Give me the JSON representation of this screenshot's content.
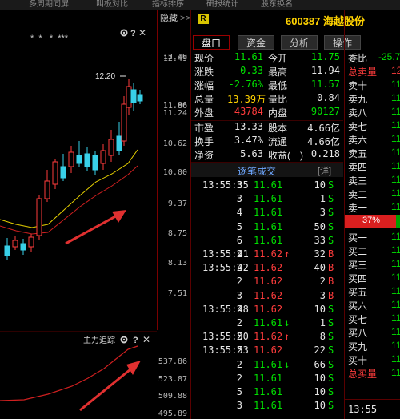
{
  "topbar": {
    "items": [
      "",
      "多周期同屏",
      "",
      "叫板对比",
      "",
      "指标排序",
      "",
      "研报统计",
      "",
      "股东换名"
    ]
  },
  "chart": {
    "hidden_label": "隐藏",
    "top_markers": "* *  * ***",
    "icons": {
      "settings": "gear-icon",
      "help": "question-icon",
      "close": "close-icon"
    },
    "high_label": "12.20",
    "price_ticks": [
      "12.49",
      "11.86",
      "11.24",
      "10.62",
      "10.00",
      "9.37",
      "8.75",
      "8.13",
      "7.51"
    ],
    "indicator_name": "主力追踪",
    "indicator_ticks": [
      "537.86",
      "523.87",
      "509.88",
      "495.89"
    ]
  },
  "quote": {
    "code": "600387",
    "name": "海越股份",
    "badge": "R",
    "tabs": [
      "盘口",
      "资金",
      "分析",
      "操作"
    ],
    "fields": [
      {
        "l1": "现价",
        "v1": "11.61",
        "c1": "green",
        "l2": "今开",
        "v2": "11.75",
        "c2": "green"
      },
      {
        "l1": "涨跌",
        "v1": "-0.33",
        "c1": "green",
        "l2": "最高",
        "v2": "11.94",
        "c2": "white"
      },
      {
        "l1": "涨幅",
        "v1": "-2.76%",
        "c1": "green",
        "l2": "最低",
        "v2": "11.57",
        "c2": "green"
      },
      {
        "l1": "总量",
        "v1": "13.39万",
        "c1": "yellow",
        "l2": "量比",
        "v2": "0.84",
        "c2": "white"
      },
      {
        "l1": "外盘",
        "v1": "43784",
        "c1": "red",
        "l2": "内盘",
        "v2": "90127",
        "c2": "green"
      }
    ],
    "fields2": [
      {
        "l1": "市盈",
        "v1": "13.33",
        "l2": "股本",
        "v2": "4.66亿"
      },
      {
        "l1": "换手",
        "v1": "3.47%",
        "l2": "流通",
        "v2": "4.66亿"
      },
      {
        "l1": "净资",
        "v1": "5.63",
        "l2": "收益(一)",
        "v2": "0.218"
      }
    ],
    "ticks_title": "逐笔成交",
    "ticks_detail": "[详]",
    "ticks": [
      {
        "t": "13:55:35",
        "v": "3",
        "p": "11.61",
        "a": "",
        "n": "10",
        "s": "S"
      },
      {
        "t": "",
        "v": "3",
        "p": "11.61",
        "a": "",
        "n": "1",
        "s": "S"
      },
      {
        "t": "",
        "v": "4",
        "p": "11.61",
        "a": "",
        "n": "3",
        "s": "S"
      },
      {
        "t": "",
        "v": "5",
        "p": "11.61",
        "a": "",
        "n": "50",
        "s": "S"
      },
      {
        "t": "",
        "v": "6",
        "p": "11.61",
        "a": "",
        "n": "33",
        "s": "S"
      },
      {
        "t": "13:55:41",
        "v": "2",
        "p": "11.62",
        "a": "up",
        "n": "32",
        "s": "B"
      },
      {
        "t": "13:55:42",
        "v": "2",
        "p": "11.62",
        "a": "",
        "n": "40",
        "s": "B"
      },
      {
        "t": "",
        "v": "2",
        "p": "11.62",
        "a": "",
        "n": "2",
        "s": "B"
      },
      {
        "t": "",
        "v": "3",
        "p": "11.62",
        "a": "",
        "n": "3",
        "s": "B"
      },
      {
        "t": "13:55:48",
        "v": "2",
        "p": "11.62",
        "a": "",
        "n": "10",
        "s": "S"
      },
      {
        "t": "",
        "v": "2",
        "p": "11.61",
        "a": "down",
        "n": "1",
        "s": "S"
      },
      {
        "t": "13:55:50",
        "v": "2",
        "p": "11.62",
        "a": "up",
        "n": "8",
        "s": "S"
      },
      {
        "t": "13:55:53",
        "v": "2",
        "p": "11.62",
        "a": "",
        "n": "22",
        "s": "S"
      },
      {
        "t": "",
        "v": "2",
        "p": "11.61",
        "a": "down",
        "n": "66",
        "s": "S"
      },
      {
        "t": "",
        "v": "2",
        "p": "11.61",
        "a": "",
        "n": "10",
        "s": "S"
      },
      {
        "t": "",
        "v": "5",
        "p": "11.61",
        "a": "",
        "n": "10",
        "s": "S"
      },
      {
        "t": "",
        "v": "3",
        "p": "11.61",
        "a": "",
        "n": "10",
        "s": "S"
      }
    ]
  },
  "book": {
    "ratio_label": "委比",
    "ratio_value": "-25.7",
    "total_sell": "总卖量",
    "total_sell_val": "12",
    "sells": [
      "卖十",
      "卖九",
      "卖八",
      "卖七",
      "卖六",
      "卖五",
      "卖四",
      "卖三",
      "卖二",
      "卖一"
    ],
    "sell_vals": [
      "11",
      "11",
      "11",
      "11",
      "11",
      "11",
      "11",
      "11",
      "11",
      "11"
    ],
    "bar_pct": "37%",
    "buys": [
      "买一",
      "买二",
      "买三",
      "买四",
      "买五",
      "买六",
      "买七",
      "买八",
      "买九",
      "买十"
    ],
    "buy_vals": [
      "11",
      "11",
      "11",
      "11",
      "11",
      "11",
      "11",
      "11",
      "11",
      "11"
    ],
    "total_buy": "总买量",
    "total_buy_val": "11",
    "time": "13:55",
    "colors": {
      "accent_red": "#ff3c3c",
      "accent_green": "#00e000",
      "bar_red": "#d91f1f"
    }
  }
}
